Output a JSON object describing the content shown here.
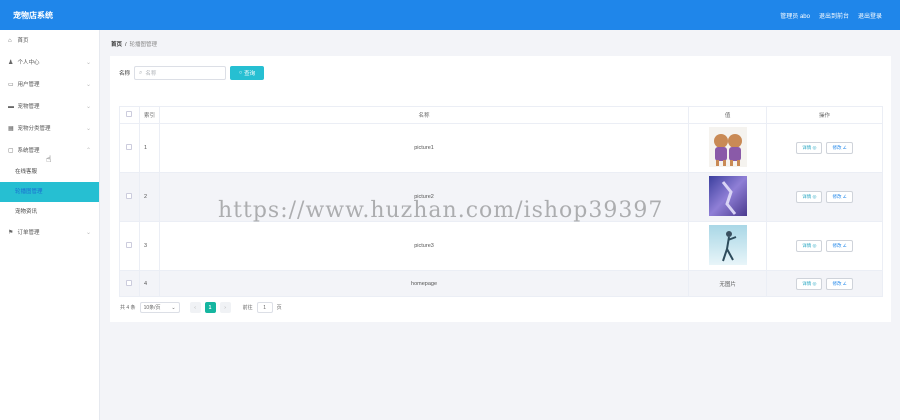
{
  "app": {
    "title": "宠物店系统"
  },
  "topbar": {
    "role_user": "管理员 abo",
    "back": "退出到前台",
    "logout": "退出登录"
  },
  "sidebar": {
    "items": [
      {
        "label": "首页",
        "icon": "home-icon"
      },
      {
        "label": "个人中心",
        "icon": "user-icon"
      },
      {
        "label": "用户管理",
        "icon": "chat-icon"
      },
      {
        "label": "宠物管理",
        "icon": "list-icon"
      },
      {
        "label": "宠物分类管理",
        "icon": "grid-icon"
      },
      {
        "label": "系统管理",
        "icon": "system-icon"
      }
    ],
    "sub_items": [
      "在线客服",
      "轮播图管理",
      "宠物资讯"
    ],
    "last_item": {
      "label": "订单管理",
      "icon": "flag-icon"
    }
  },
  "breadcrumb": {
    "home": "首页",
    "sep": "/",
    "current": "轮播图管理"
  },
  "search": {
    "label": "名称",
    "placeholder": "名称",
    "button": "查询"
  },
  "table": {
    "headers": {
      "index": "索引",
      "name": "名称",
      "value": "值",
      "ops": "操作"
    },
    "rows": [
      {
        "index": "1",
        "name": "picture1",
        "value": "",
        "image": "dogs"
      },
      {
        "index": "2",
        "name": "picture2",
        "value": "",
        "image": "purple"
      },
      {
        "index": "3",
        "name": "picture3",
        "value": "",
        "image": "figure"
      },
      {
        "index": "4",
        "name": "homepage",
        "value": "无图片",
        "image": ""
      }
    ],
    "view_label": "详情 ◎",
    "edit_label": "修改 ∠"
  },
  "pager": {
    "total": "共 4 条",
    "size": "10条/页",
    "page": "1",
    "goto": "前往",
    "goto_value": "1",
    "unit": "页"
  },
  "watermark": "https://www.huzhan.com/ishop39397",
  "colors": {
    "primary": "#1f86ea",
    "accent": "#26bfd2",
    "active_page": "#15b6a0"
  }
}
